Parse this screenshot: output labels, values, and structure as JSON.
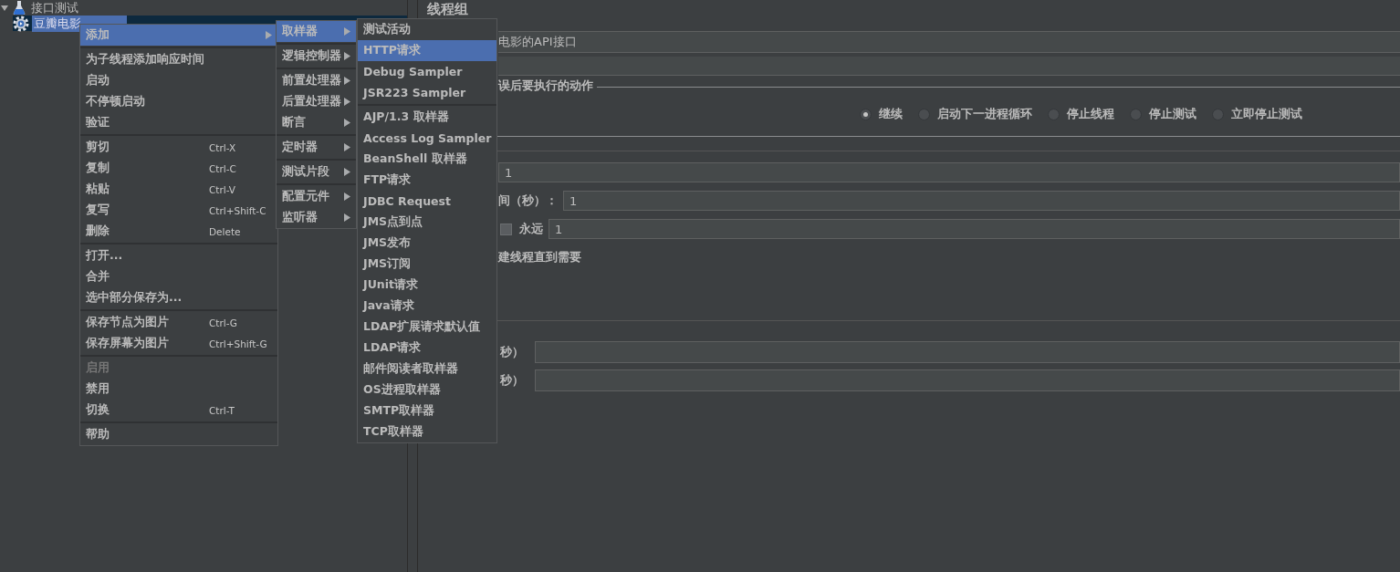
{
  "tree": [
    {
      "label": "接口测试",
      "expanded": true,
      "selected": false,
      "children": [
        {
          "label": "豆瓣电影",
          "selected": true
        }
      ]
    }
  ],
  "menus": [
    {
      "groups": [
        {
          "items": [
            {
              "label": "添加",
              "submenu": true,
              "selected": true,
              "disabled": false
            }
          ]
        },
        {
          "items": [
            {
              "label": "为子线程添加响应时间",
              "selected": false,
              "disabled": false
            },
            {
              "label": "启动",
              "selected": false,
              "disabled": false
            },
            {
              "label": "不停顿启动",
              "selected": false,
              "disabled": false
            },
            {
              "label": "验证",
              "selected": false,
              "disabled": false
            }
          ]
        },
        {
          "items": [
            {
              "label": "剪切",
              "shortcut": "Ctrl-X",
              "selected": false,
              "disabled": false
            },
            {
              "label": "复制",
              "shortcut": "Ctrl-C",
              "selected": false,
              "disabled": false
            },
            {
              "label": "粘贴",
              "shortcut": "Ctrl-V",
              "selected": false,
              "disabled": false
            },
            {
              "label": "复写",
              "shortcut": "Ctrl+Shift-C",
              "selected": false,
              "disabled": false
            },
            {
              "label": "删除",
              "shortcut": "Delete",
              "selected": false,
              "disabled": false
            }
          ]
        },
        {
          "items": [
            {
              "label": "打开...",
              "selected": false,
              "disabled": false
            },
            {
              "label": "合并",
              "selected": false,
              "disabled": false
            },
            {
              "label": "选中部分保存为...",
              "selected": false,
              "disabled": false
            }
          ]
        },
        {
          "items": [
            {
              "label": "保存节点为图片",
              "shortcut": "Ctrl-G",
              "selected": false,
              "disabled": false
            },
            {
              "label": "保存屏幕为图片",
              "shortcut": "Ctrl+Shift-G",
              "selected": false,
              "disabled": false
            }
          ]
        },
        {
          "items": [
            {
              "label": "启用",
              "selected": false,
              "disabled": true
            },
            {
              "label": "禁用",
              "selected": false,
              "disabled": false
            },
            {
              "label": "切换",
              "shortcut": "Ctrl-T",
              "selected": false,
              "disabled": false
            }
          ]
        },
        {
          "items": [
            {
              "label": "帮助",
              "selected": false,
              "disabled": false
            }
          ]
        }
      ]
    },
    {
      "groups": [
        {
          "items": [
            {
              "label": "取样器",
              "submenu": true,
              "selected": true
            }
          ]
        },
        {
          "items": [
            {
              "label": "逻辑控制器",
              "submenu": true,
              "selected": false
            }
          ]
        },
        {
          "items": [
            {
              "label": "前置处理器",
              "submenu": true,
              "selected": false
            },
            {
              "label": "后置处理器",
              "submenu": true,
              "selected": false
            },
            {
              "label": "断言",
              "submenu": true,
              "selected": false
            }
          ]
        },
        {
          "items": [
            {
              "label": "定时器",
              "submenu": true,
              "selected": false
            }
          ]
        },
        {
          "items": [
            {
              "label": "测试片段",
              "submenu": true,
              "selected": false
            }
          ]
        },
        {
          "items": [
            {
              "label": "配置元件",
              "submenu": true,
              "selected": false
            },
            {
              "label": "监听器",
              "submenu": true,
              "selected": false
            }
          ]
        }
      ]
    },
    {
      "groups": [
        {
          "items": [
            {
              "label": "测试活动",
              "selected": false
            },
            {
              "label": "HTTP请求",
              "selected": true
            },
            {
              "label": "Debug Sampler",
              "selected": false
            },
            {
              "label": "JSR223 Sampler",
              "selected": false
            }
          ]
        },
        {
          "items": [
            {
              "label": "AJP/1.3 取样器",
              "selected": false
            },
            {
              "label": "Access Log Sampler",
              "selected": false
            },
            {
              "label": "BeanShell 取样器",
              "selected": false
            },
            {
              "label": "FTP请求",
              "selected": false
            },
            {
              "label": "JDBC Request",
              "selected": false
            },
            {
              "label": "JMS点到点",
              "selected": false
            },
            {
              "label": "JMS发布",
              "selected": false
            },
            {
              "label": "JMS订阅",
              "selected": false
            },
            {
              "label": "JUnit请求",
              "selected": false
            },
            {
              "label": "Java请求",
              "selected": false
            },
            {
              "label": "LDAP扩展请求默认值",
              "selected": false
            },
            {
              "label": "LDAP请求",
              "selected": false
            },
            {
              "label": "邮件阅读者取样器",
              "selected": false
            },
            {
              "label": "OS进程取样器",
              "selected": false
            },
            {
              "label": "SMTP取样器",
              "selected": false
            },
            {
              "label": "TCP取样器",
              "selected": false
            }
          ]
        }
      ]
    }
  ],
  "panel": {
    "title": "线程组",
    "name_field": {
      "value": "电影的API接口"
    },
    "error_action": {
      "label": "误后要执行的动作",
      "options": [
        {
          "label": "继续",
          "selected": true
        },
        {
          "label": "启动下一进程循环",
          "selected": false
        },
        {
          "label": "停止线程",
          "selected": false
        },
        {
          "label": "停止测试",
          "selected": false
        },
        {
          "label": "立即停止测试",
          "selected": false
        }
      ]
    },
    "rows": [
      {
        "kind": "field",
        "value": "1"
      },
      {
        "kind": "field",
        "label": "间（秒）：",
        "value": "1"
      },
      {
        "kind": "loop",
        "checkbox_label": "永远",
        "checked": false,
        "value": "1"
      },
      {
        "kind": "text",
        "label": "建线程直到需要"
      }
    ],
    "scheduler_rows": [
      {
        "label": "秒）"
      },
      {
        "label": "秒）"
      }
    ]
  }
}
